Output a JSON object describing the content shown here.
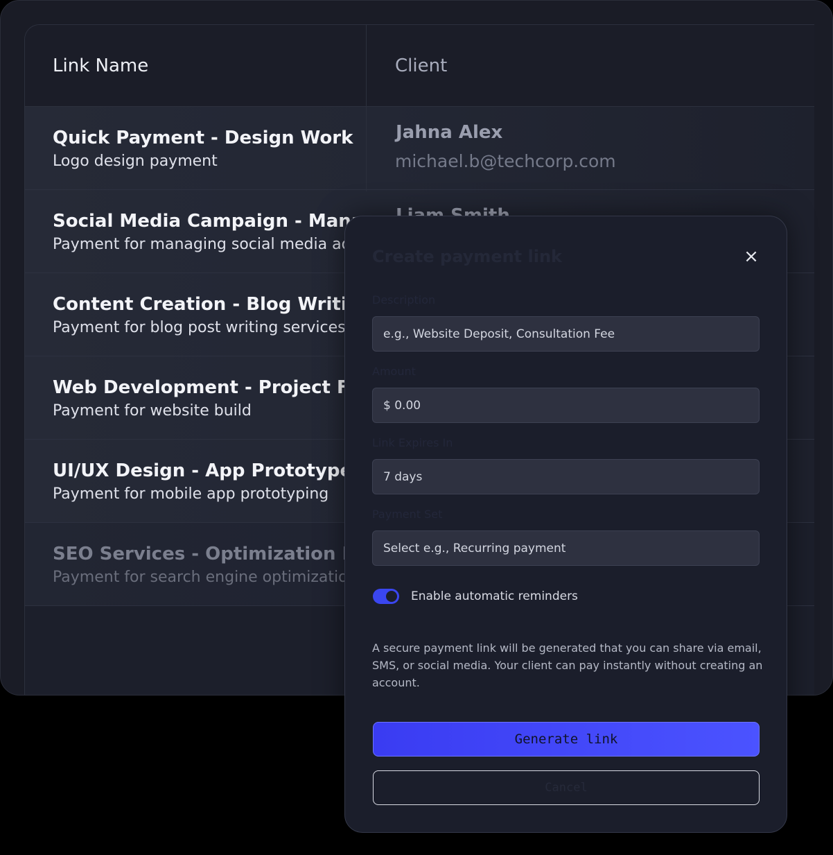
{
  "table": {
    "headers": {
      "link_name": "Link Name",
      "client": "Client"
    },
    "rows": [
      {
        "title": "Quick Payment - Design Work",
        "subtitle": "Logo design payment",
        "client_name": "Jahna Alex",
        "client_email": "michael.b@techcorp.com"
      },
      {
        "title": "Social Media Campaign - Management",
        "subtitle": "Payment for managing social media ads",
        "client_name": "Liam Smith",
        "client_email": ""
      },
      {
        "title": "Content Creation - Blog Writing",
        "subtitle": "Payment for blog post writing services",
        "client_name": "",
        "client_email": ""
      },
      {
        "title": "Web Development - Project Fee",
        "subtitle": "Payment for website build",
        "client_name": "",
        "client_email": ""
      },
      {
        "title": "UI/UX Design - App Prototype",
        "subtitle": "Payment for mobile app prototyping",
        "client_name": "",
        "client_email": ""
      },
      {
        "title": "SEO Services - Optimization Fee",
        "subtitle": "Payment for search engine optimization",
        "client_name": "",
        "client_email": ""
      }
    ]
  },
  "modal": {
    "title": "Create payment link",
    "close_icon": "×",
    "fields": {
      "description": {
        "label": "Description",
        "placeholder": "e.g., Website Deposit, Consultation Fee"
      },
      "amount": {
        "label": "Amount",
        "value": "$ 0.00"
      },
      "expires": {
        "label": "Link Expires In",
        "value": "7 days"
      },
      "payment_type": {
        "label": "Payment Set",
        "placeholder": "Select e.g., Recurring payment"
      }
    },
    "reminders": {
      "label": "Enable automatic reminders",
      "enabled": true
    },
    "info": "A secure payment link will be generated that you can share via email, SMS, or social media. Your client can pay instantly without creating an account.",
    "generate_label": "Generate link",
    "cancel_label": "Cancel"
  },
  "colors": {
    "accent": "#3a46f0",
    "background": "#1a1c26",
    "modal": "#1b1e2b"
  }
}
